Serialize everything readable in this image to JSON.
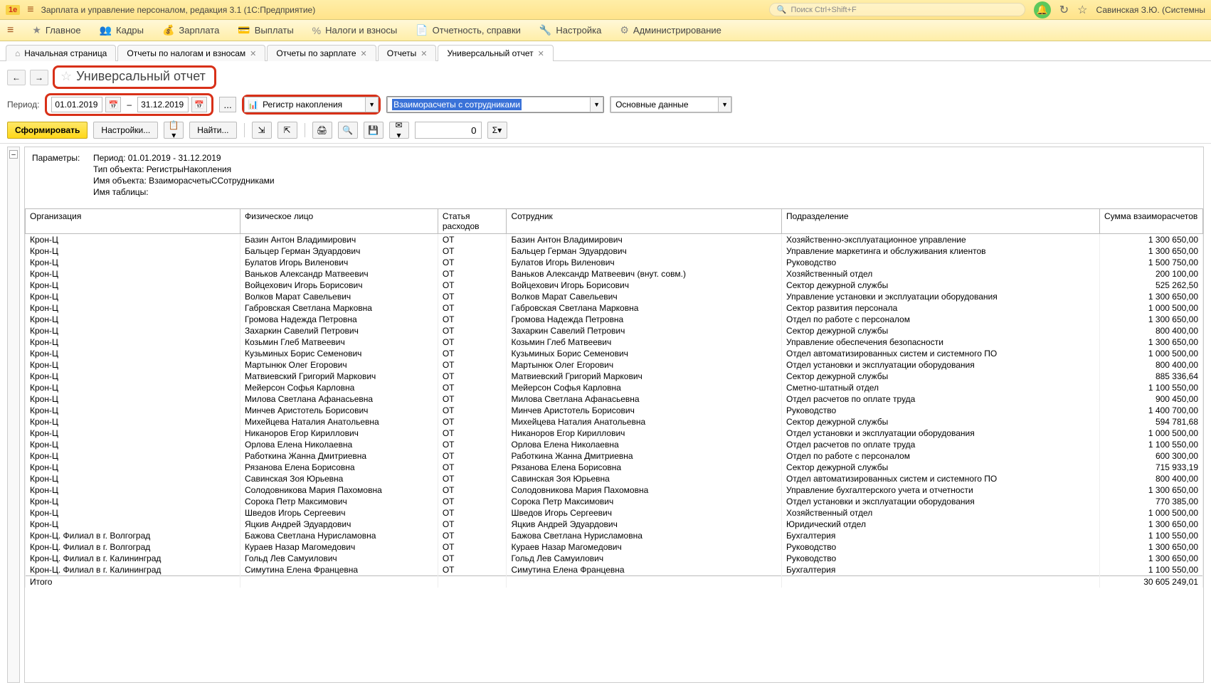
{
  "app_title": "Зарплата и управление персоналом, редакция 3.1  (1С:Предприятие)",
  "search_placeholder": "Поиск Ctrl+Shift+F",
  "user_name": "Савинская З.Ю. (Системны",
  "main_menu": [
    "Главное",
    "Кадры",
    "Зарплата",
    "Выплаты",
    "Налоги и взносы",
    "Отчетность, справки",
    "Настройка",
    "Администрирование"
  ],
  "tabs": [
    {
      "label": "Начальная страница",
      "home": true,
      "close": false
    },
    {
      "label": "Отчеты по налогам и взносам",
      "close": true
    },
    {
      "label": "Отчеты по зарплате",
      "close": true
    },
    {
      "label": "Отчеты",
      "close": true
    },
    {
      "label": "Универсальный отчет",
      "close": true,
      "active": true
    }
  ],
  "page_title": "Универсальный отчет",
  "period_label": "Период:",
  "date_from": "01.01.2019",
  "date_to": "31.12.2019",
  "combo_register": "Регистр накопления",
  "combo_object": "Взаиморасчеты с сотрудниками",
  "combo_table": "Основные данные",
  "btn_form": "Сформировать",
  "btn_settings": "Настройки...",
  "btn_find": "Найти...",
  "search_value": "0",
  "params_label": "Параметры:",
  "params": {
    "period": "Период: 01.01.2019 - 31.12.2019",
    "type": "Тип объекта: РегистрыНакопления",
    "name": "Имя объекта: ВзаиморасчетыССотрудниками",
    "table": "Имя таблицы:"
  },
  "headers": {
    "org": "Организация",
    "fiz": "Физическое лицо",
    "stat": "Статья расходов",
    "sotr": "Сотрудник",
    "podr": "Подразделение",
    "sum": "Сумма взаиморасчетов"
  },
  "rows": [
    [
      "Крон-Ц",
      "Базин Антон Владимирович",
      "ОТ",
      "Базин Антон Владимирович",
      "Хозяйственно-эксплуатационное управление",
      "1 300 650,00"
    ],
    [
      "Крон-Ц",
      "Бальцер Герман Эдуардович",
      "ОТ",
      "Бальцер Герман Эдуардович",
      "Управление маркетинга и обслуживания клиентов",
      "1 300 650,00"
    ],
    [
      "Крон-Ц",
      "Булатов Игорь Виленович",
      "ОТ",
      "Булатов Игорь Виленович",
      "Руководство",
      "1 500 750,00"
    ],
    [
      "Крон-Ц",
      "Ваньков Александр Матвеевич",
      "ОТ",
      "Ваньков Александр Матвеевич (внут. совм.)",
      "Хозяйственный отдел",
      "200 100,00"
    ],
    [
      "Крон-Ц",
      "Войцехович Игорь Борисович",
      "ОТ",
      "Войцехович Игорь Борисович",
      "Сектор дежурной службы",
      "525 262,50"
    ],
    [
      "Крон-Ц",
      "Волков Марат Савельевич",
      "ОТ",
      "Волков Марат Савельевич",
      "Управление установки и эксплуатации оборудования",
      "1 300 650,00"
    ],
    [
      "Крон-Ц",
      "Габровская Светлана Марковна",
      "ОТ",
      "Габровская Светлана Марковна",
      "Сектор развития персонала",
      "1 000 500,00"
    ],
    [
      "Крон-Ц",
      "Громова Надежда Петровна",
      "ОТ",
      "Громова Надежда Петровна",
      "Отдел по работе с персоналом",
      "1 300 650,00"
    ],
    [
      "Крон-Ц",
      "Захаркин Савелий Петрович",
      "ОТ",
      "Захаркин Савелий Петрович",
      "Сектор дежурной службы",
      "800 400,00"
    ],
    [
      "Крон-Ц",
      "Козьмин Глеб Матвеевич",
      "ОТ",
      "Козьмин Глеб Матвеевич",
      "Управление обеспечения безопасности",
      "1 300 650,00"
    ],
    [
      "Крон-Ц",
      "Кузьминых Борис Семенович",
      "ОТ",
      "Кузьминых Борис Семенович",
      "Отдел автоматизированных систем и системного ПО",
      "1 000 500,00"
    ],
    [
      "Крон-Ц",
      "Мартынюк Олег Егорович",
      "ОТ",
      "Мартынюк Олег Егорович",
      "Отдел установки и эксплуатации оборудования",
      "800 400,00"
    ],
    [
      "Крон-Ц",
      "Матвиевский Григорий Маркович",
      "ОТ",
      "Матвиевский Григорий Маркович",
      "Сектор дежурной службы",
      "885 336,64"
    ],
    [
      "Крон-Ц",
      "Мейерсон Софья Карловна",
      "ОТ",
      "Мейерсон Софья Карловна",
      "Сметно-штатный отдел",
      "1 100 550,00"
    ],
    [
      "Крон-Ц",
      "Милова Светлана Афанасьевна",
      "ОТ",
      "Милова Светлана Афанасьевна",
      "Отдел расчетов по оплате труда",
      "900 450,00"
    ],
    [
      "Крон-Ц",
      "Минчев Аристотель Борисович",
      "ОТ",
      "Минчев Аристотель Борисович",
      "Руководство",
      "1 400 700,00"
    ],
    [
      "Крон-Ц",
      "Михейцева Наталия Анатольевна",
      "ОТ",
      "Михейцева Наталия Анатольевна",
      "Сектор дежурной службы",
      "594 781,68"
    ],
    [
      "Крон-Ц",
      "Никаноров Егор Кириллович",
      "ОТ",
      "Никаноров Егор Кириллович",
      "Отдел установки и эксплуатации оборудования",
      "1 000 500,00"
    ],
    [
      "Крон-Ц",
      "Орлова Елена Николаевна",
      "ОТ",
      "Орлова Елена Николаевна",
      "Отдел расчетов по оплате труда",
      "1 100 550,00"
    ],
    [
      "Крон-Ц",
      "Работкина Жанна Дмитриевна",
      "ОТ",
      "Работкина Жанна Дмитриевна",
      "Отдел по работе с персоналом",
      "600 300,00"
    ],
    [
      "Крон-Ц",
      "Рязанова Елена Борисовна",
      "ОТ",
      "Рязанова Елена Борисовна",
      "Сектор дежурной службы",
      "715 933,19"
    ],
    [
      "Крон-Ц",
      "Савинская Зоя Юрьевна",
      "ОТ",
      "Савинская Зоя Юрьевна",
      "Отдел автоматизированных систем и системного ПО",
      "800 400,00"
    ],
    [
      "Крон-Ц",
      "Солодовникова Мария Пахомовна",
      "ОТ",
      "Солодовникова Мария Пахомовна",
      "Управление бухгалтерского учета и отчетности",
      "1 300 650,00"
    ],
    [
      "Крон-Ц",
      "Сорока Петр Максимович",
      "ОТ",
      "Сорока Петр Максимович",
      "Отдел установки и эксплуатации оборудования",
      "770 385,00"
    ],
    [
      "Крон-Ц",
      "Шведов Игорь Сергеевич",
      "ОТ",
      "Шведов Игорь Сергеевич",
      "Хозяйственный отдел",
      "1 000 500,00"
    ],
    [
      "Крон-Ц",
      "Яцкив Андрей Эдуардович",
      "ОТ",
      "Яцкив Андрей Эдуардович",
      "Юридический отдел",
      "1 300 650,00"
    ],
    [
      "Крон-Ц. Филиал в г. Волгоград",
      "Бажова Светлана Нурисламовна",
      "ОТ",
      "Бажова Светлана Нурисламовна",
      "Бухгалтерия",
      "1 100 550,00"
    ],
    [
      "Крон-Ц. Филиал в г. Волгоград",
      "Кураев Назар Магомедович",
      "ОТ",
      "Кураев Назар Магомедович",
      "Руководство",
      "1 300 650,00"
    ],
    [
      "Крон-Ц. Филиал в г. Калининград",
      "Гольд Лев Самуилович",
      "ОТ",
      "Гольд Лев Самуилович",
      "Руководство",
      "1 300 650,00"
    ],
    [
      "Крон-Ц. Филиал в г. Калининград",
      "Симутина Елена Францевна",
      "ОТ",
      "Симутина Елена Францевна",
      "Бухгалтерия",
      "1 100 550,00"
    ]
  ],
  "total_label": "Итого",
  "total_sum": "30 605 249,01"
}
